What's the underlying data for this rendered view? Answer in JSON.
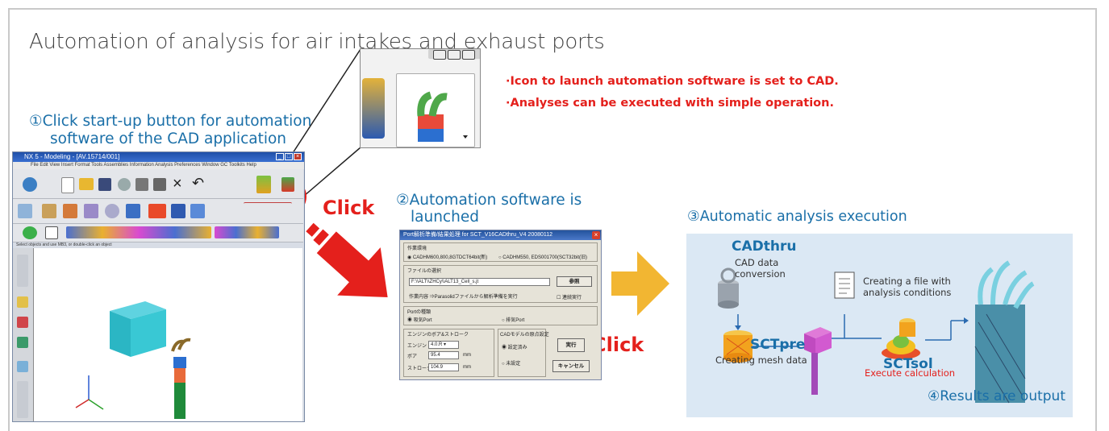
{
  "title": "Automation of analysis for air intakes and exhaust ports",
  "notes": [
    "·Icon to launch automation software is set to CAD.",
    "·Analyses can be executed with simple operation."
  ],
  "step1": {
    "line1": "①Click start-up button for automation",
    "line2": "software of the CAD application"
  },
  "step2": {
    "line1": "②Automation software  is",
    "line2": "launched"
  },
  "step3": "③Automatic analysis execution",
  "click_label": "Click",
  "cad_window": {
    "title": "NX 5 - Modeling - [AV.15714/001]",
    "menu": "File  Edit  View  Insert  Format  Tools  Assemblies  Information  Analysis  Preferences  Window  GC Toolkits  Help",
    "status": "Select objects and use MB3, or double-click an object"
  },
  "dialog": {
    "title": "Port解析準備/結果処理  for  SCT_V16CADthru_V4  20080112",
    "group_env": "作業環境",
    "env_opt1": "CADHM600,800,8GTDCT64bit(新)",
    "env_opt2": "CADHM550, EDS001700(SCT32bit(旧)",
    "file_label": "ファイルの選択",
    "file_value": "F:\\\\ALT\\\\ZHCy\\\\ALT13_Cell_s.jt",
    "ref_button": "参照",
    "work_label": "作業内容  ⇒Parasolidファイルから解析準備を実行",
    "continuous": "連続実行",
    "port_group": "Portの種類",
    "port_in": "吸気Port",
    "port_ex": "排気Port",
    "engine_group": "エンジンのボア&ストローク",
    "engine_label": "エンジン",
    "engine_value": "4.0.R",
    "bore_label": "ボア",
    "bore_value": "95.4",
    "stroke_label": "ストローク",
    "stroke_value": "104.9",
    "unit": "mm",
    "cad_group": "CADモデルの原点設定",
    "cad_opt1": "設定済み",
    "cad_opt2": "未設定",
    "run_button": "実行",
    "cancel_button": "キャンセル"
  },
  "flow": {
    "cadthru": "CADthru",
    "cadthru_desc": [
      "CAD data",
      "conversion"
    ],
    "file_desc": [
      "Creating a file with",
      "analysis conditions"
    ],
    "sctpre": "SCTpre",
    "sctpre_desc": "Creating mesh data",
    "sctsol": "SCTsol",
    "sctsol_desc": "Execute calculation",
    "result": "④Results are output"
  },
  "colors": {
    "accent_red": "#e4201c",
    "heading_blue": "#1a6fa8",
    "panel_bg": "#dbe8f4",
    "arrow_orange": "#f2b632"
  }
}
